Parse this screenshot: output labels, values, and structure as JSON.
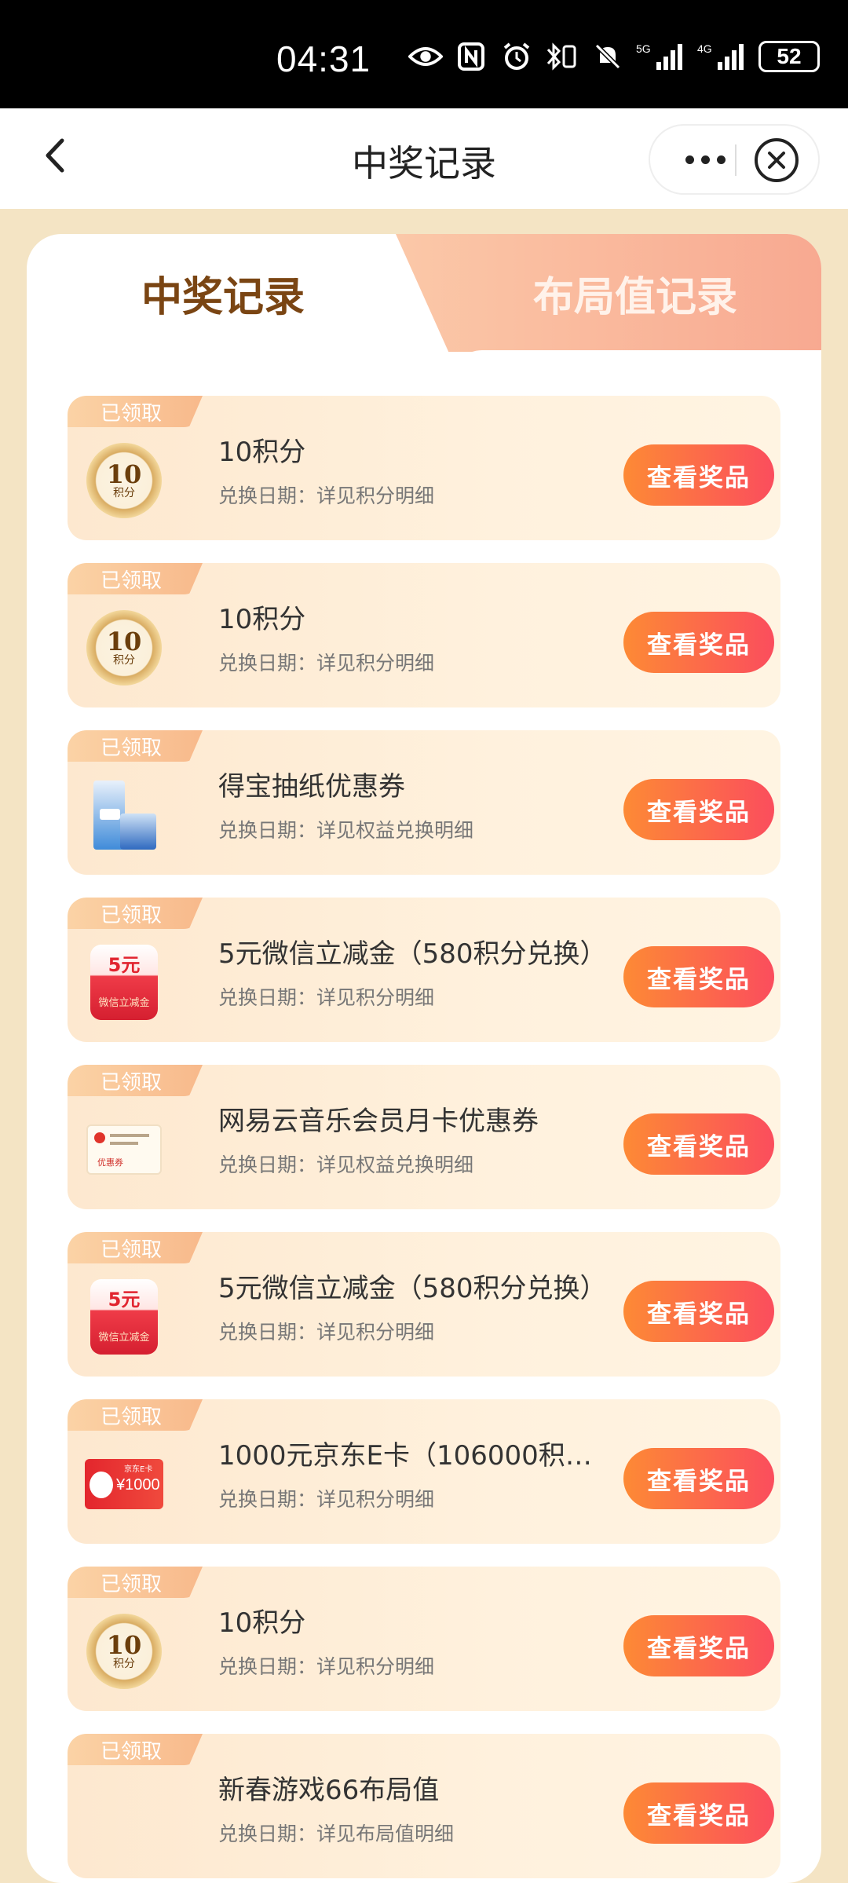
{
  "status": {
    "time": "04:31",
    "battery": "52"
  },
  "nav": {
    "title": "中奖记录"
  },
  "tabs": {
    "active": "中奖记录",
    "inactive": "布局值记录"
  },
  "records": [
    {
      "badge": "已领取",
      "title": "10积分",
      "sub": "兑换日期：详见积分明细",
      "button": "查看奖品",
      "thumb": "coin",
      "coin_value": "10",
      "coin_unit": "积分"
    },
    {
      "badge": "已领取",
      "title": "10积分",
      "sub": "兑换日期：详见积分明细",
      "button": "查看奖品",
      "thumb": "coin",
      "coin_value": "10",
      "coin_unit": "积分"
    },
    {
      "badge": "已领取",
      "title": "得宝抽纸优惠券",
      "sub": "兑换日期：详见权益兑换明细",
      "button": "查看奖品",
      "thumb": "tissue"
    },
    {
      "badge": "已领取",
      "title": "5元微信立减金（580积分兑换）",
      "sub": "兑换日期：详见积分明细",
      "button": "查看奖品",
      "thumb": "redpacket",
      "pkt_amount": "5元",
      "pkt_label": "微信立减金"
    },
    {
      "badge": "已领取",
      "title": "网易云音乐会员月卡优惠券",
      "sub": "兑换日期：详见权益兑换明细",
      "button": "查看奖品",
      "thumb": "music",
      "music_label": "优惠券"
    },
    {
      "badge": "已领取",
      "title": "5元微信立减金（580积分兑换）",
      "sub": "兑换日期：详见积分明细",
      "button": "查看奖品",
      "thumb": "redpacket",
      "pkt_amount": "5元",
      "pkt_label": "微信立减金"
    },
    {
      "badge": "已领取",
      "title": "1000元京东E卡（106000积分…",
      "sub": "兑换日期：详见积分明细",
      "button": "查看奖品",
      "thumb": "jdcard",
      "jd_brand": "京东E卡",
      "jd_amount": "¥1000"
    },
    {
      "badge": "已领取",
      "title": "10积分",
      "sub": "兑换日期：详见积分明细",
      "button": "查看奖品",
      "thumb": "coin",
      "coin_value": "10",
      "coin_unit": "积分"
    },
    {
      "badge": "已领取",
      "title": "新春游戏66布局值",
      "sub": "兑换日期：详见布局值明细",
      "button": "查看奖品",
      "thumb": "blank"
    }
  ]
}
